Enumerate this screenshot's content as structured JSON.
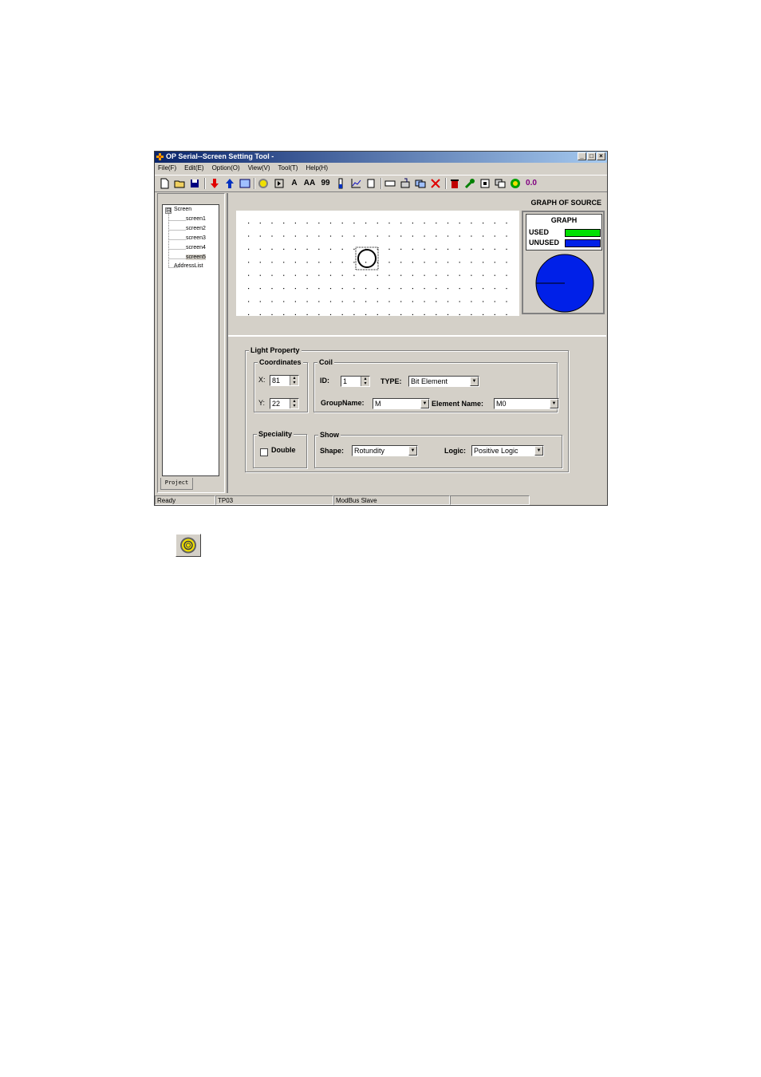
{
  "window": {
    "title": "OP Serial--Screen Setting Tool -",
    "controls": [
      "_",
      "□",
      "×"
    ]
  },
  "menu": [
    "File(F)",
    "Edit(E)",
    "Option(O)",
    "View(V)",
    "Tool(T)",
    "Help(H)"
  ],
  "toolbar": {
    "text_tool": "A",
    "double_text_tool": "AA",
    "number_tool": "99",
    "float_tool": "0.0"
  },
  "tree": {
    "root": "Screen",
    "expander": "⊟",
    "items": [
      "screen1",
      "screen2",
      "screen3",
      "screen4",
      "screen5"
    ],
    "address_list": "AddressList",
    "tab": "Project"
  },
  "source_graph": {
    "title": "GRAPH OF SOURCE",
    "box_title": "GRAPH",
    "used_label": "USED",
    "unused_label": "UNUSED",
    "used_color": "#00e000",
    "unused_color": "#0020e8",
    "used_fraction": 0
  },
  "light_property": {
    "title": "Light Property",
    "coordinates": {
      "title": "Coordinates",
      "x_label": "X:",
      "x_value": "81",
      "y_label": "Y:",
      "y_value": "22"
    },
    "coil": {
      "title": "Coil",
      "id_label": "ID:",
      "id_value": "1",
      "type_label": "TYPE:",
      "type_value": "Bit Element",
      "group_label": "GroupName:",
      "group_value": "M",
      "element_label": "Element Name:",
      "element_value": "M0"
    },
    "speciality": {
      "title": "Speciality",
      "double_label": "Double",
      "double_checked": false
    },
    "show": {
      "title": "Show",
      "shape_label": "Shape:",
      "shape_value": "Rotundity",
      "logic_label": "Logic:",
      "logic_value": "Positive Logic"
    }
  },
  "status": {
    "state": "Ready",
    "device": "TP03",
    "protocol": "ModBus Slave",
    "extra": ""
  }
}
